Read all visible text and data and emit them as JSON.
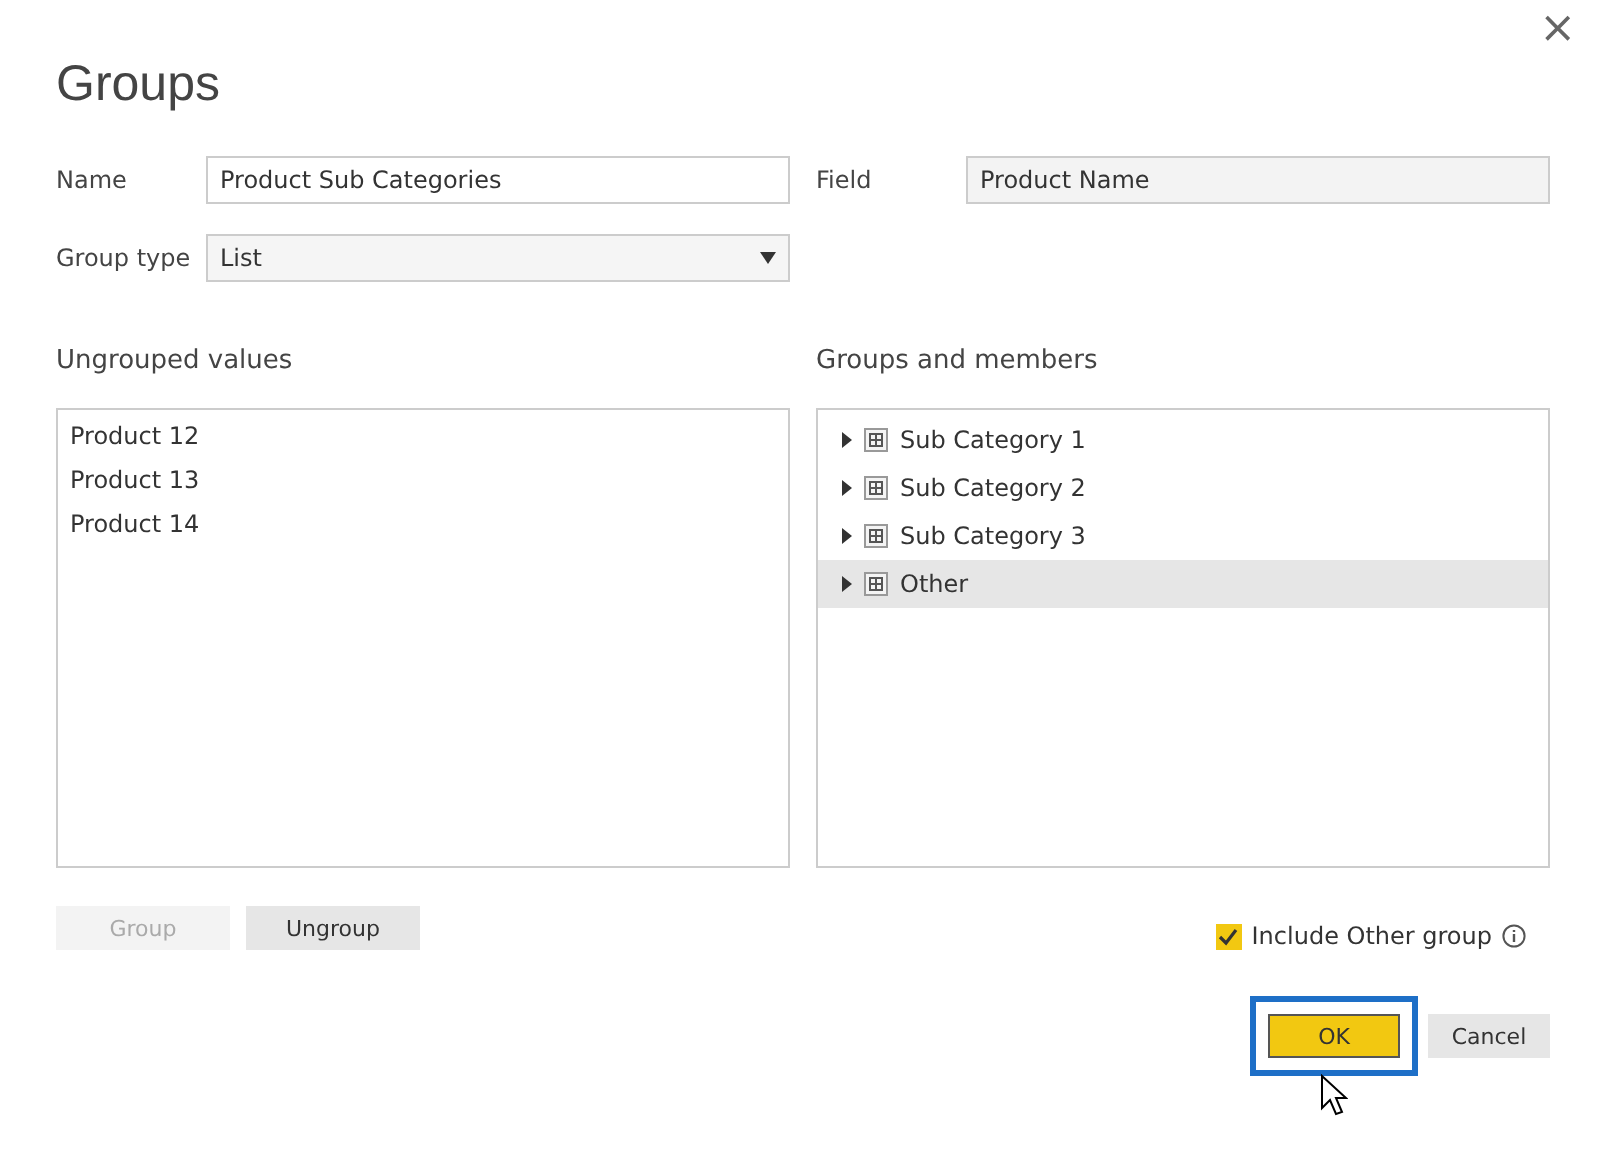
{
  "window": {
    "title": "Groups",
    "close": "×"
  },
  "fields": [
    {
      "label": "Name",
      "kind": "text",
      "value": "Product Sub Categories",
      "disabled": false
    },
    {
      "label": "Field",
      "kind": "text",
      "value": "Product Name",
      "disabled": true
    },
    {
      "label": "Group type",
      "kind": "dropdown",
      "value": "List"
    }
  ],
  "ungrouped": {
    "heading": "Ungrouped values",
    "items": [
      {
        "label": "Product 12",
        "selected": false
      },
      {
        "label": "Product 13",
        "selected": false
      },
      {
        "label": "Product 14",
        "selected": false
      }
    ]
  },
  "groups": {
    "heading": "Groups and members",
    "items": [
      {
        "label": "Sub Category 1",
        "selected": false,
        "expanded": false
      },
      {
        "label": "Sub Category 2",
        "selected": false,
        "expanded": false
      },
      {
        "label": "Sub Category 3",
        "selected": false,
        "expanded": false
      },
      {
        "label": "Other",
        "selected": true,
        "expanded": false
      }
    ]
  },
  "list_buttons": [
    {
      "label": "Group",
      "disabled": true
    },
    {
      "label": "Ungroup",
      "disabled": false
    }
  ],
  "include_other": {
    "label": "Include Other group",
    "checked": true
  },
  "footer_buttons": [
    {
      "label": "OK",
      "kind": "primary",
      "focused": true
    },
    {
      "label": "Cancel",
      "kind": "secondary",
      "focused": false
    }
  ]
}
